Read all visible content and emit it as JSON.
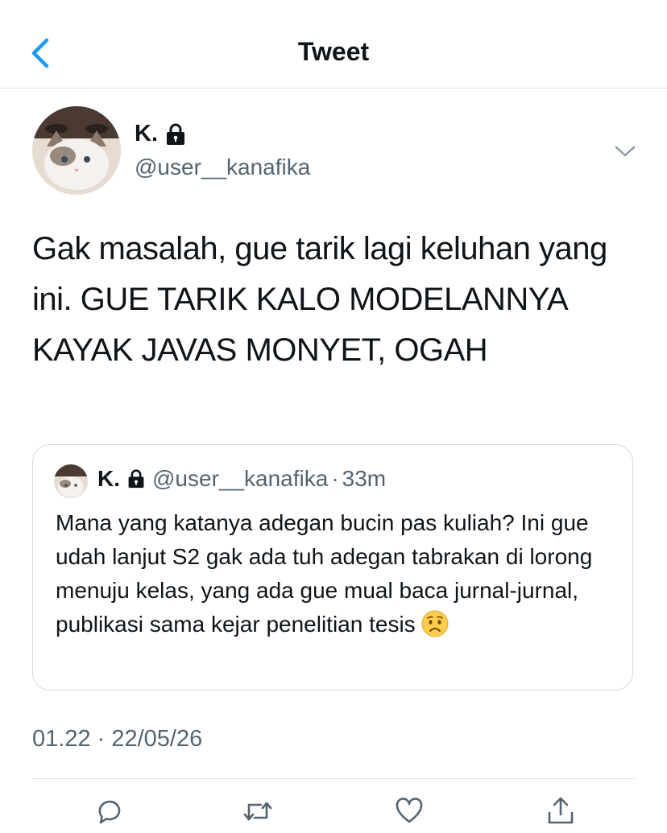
{
  "header": {
    "title": "Tweet",
    "back_icon": "chevron-left-icon"
  },
  "tweet": {
    "author_name": "K.",
    "author_handle": "@user__kanafika",
    "text": "Gak masalah, gue tarik lagi keluhan yang ini. GUE TARIK KALO MODELANNYA KAYAK JAVAS MONYET, OGAH",
    "timestamp": "01.22 · 22/05/26"
  },
  "quoted": {
    "name": "K.",
    "handle": "@user__kanafika",
    "separator": "·",
    "time": "33m",
    "text": "Mana yang katanya adegan bucin pas kuliah? Ini gue udah lanjut S2 gak ada tuh adegan tabrakan di lorong menuju kelas, yang ada gue mual baca jurnal-jurnal, publikasi sama kejar penelitian tesis",
    "emoji": "worried-face"
  },
  "actions": [
    "reply-icon",
    "retweet-icon",
    "like-icon",
    "share-icon"
  ],
  "colors": {
    "accent": "#1d9bf0",
    "secondary_text": "#536471",
    "border": "#cfd9de"
  }
}
